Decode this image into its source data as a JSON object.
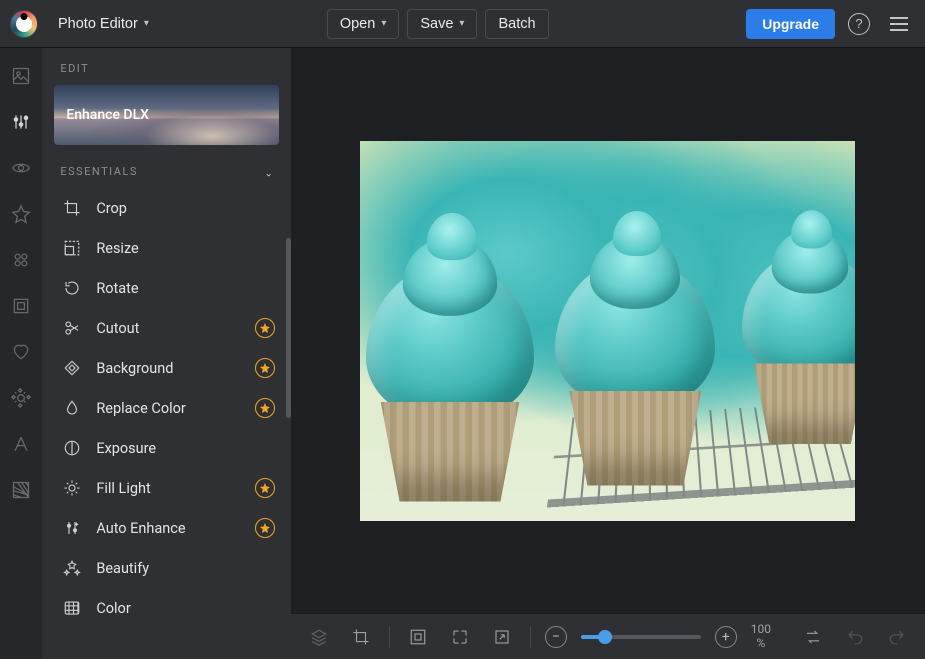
{
  "header": {
    "app_label": "Photo Editor",
    "open_label": "Open",
    "save_label": "Save",
    "batch_label": "Batch",
    "upgrade_label": "Upgrade"
  },
  "rail": {
    "items": [
      {
        "name": "image-icon"
      },
      {
        "name": "adjust-sliders-icon"
      },
      {
        "name": "eye-icon"
      },
      {
        "name": "star-icon"
      },
      {
        "name": "effects-icon"
      },
      {
        "name": "frame-icon"
      },
      {
        "name": "heart-icon"
      },
      {
        "name": "gear-icon"
      },
      {
        "name": "text-icon"
      },
      {
        "name": "texture-icon"
      }
    ]
  },
  "sidebar": {
    "panel_title": "EDIT",
    "enhance_card_label": "Enhance DLX",
    "section_title": "ESSENTIALS",
    "tools": [
      {
        "label": "Crop",
        "pro": false,
        "icon": "crop"
      },
      {
        "label": "Resize",
        "pro": false,
        "icon": "resize"
      },
      {
        "label": "Rotate",
        "pro": false,
        "icon": "rotate"
      },
      {
        "label": "Cutout",
        "pro": true,
        "icon": "cutout"
      },
      {
        "label": "Background",
        "pro": true,
        "icon": "background"
      },
      {
        "label": "Replace Color",
        "pro": true,
        "icon": "drop"
      },
      {
        "label": "Exposure",
        "pro": false,
        "icon": "exposure"
      },
      {
        "label": "Fill Light",
        "pro": true,
        "icon": "filllight"
      },
      {
        "label": "Auto Enhance",
        "pro": true,
        "icon": "autoenhance"
      },
      {
        "label": "Beautify",
        "pro": false,
        "icon": "beautify"
      },
      {
        "label": "Color",
        "pro": false,
        "icon": "color"
      }
    ]
  },
  "bottombar": {
    "zoom_value": "100",
    "zoom_suffix": "%"
  },
  "colors": {
    "accent": "#2b7de9",
    "pro_badge": "#f5a623",
    "bg_dark": "#1e1f22",
    "bg_panel": "#2e3034"
  }
}
